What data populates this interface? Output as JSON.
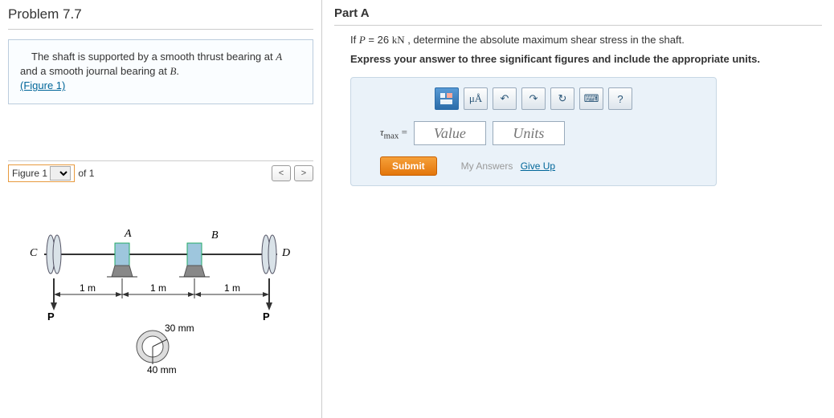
{
  "problem": {
    "title": "Problem 7.7",
    "intro_pre": "The shaft is supported by a smooth thrust bearing at ",
    "intro_A": "A",
    "intro_mid": " and a smooth journal bearing at ",
    "intro_B": "B",
    "intro_post": ".",
    "figure_link": "(Figure 1)"
  },
  "figure_bar": {
    "select_label": "Figure 1",
    "of_label": "of 1",
    "prev": "<",
    "next": ">"
  },
  "figure": {
    "labels": {
      "C": "C",
      "A": "A",
      "B": "B",
      "D": "D",
      "P1": "P",
      "P2": "P"
    },
    "dims": {
      "d1": "1 m",
      "d2": "1 m",
      "d3": "1 m",
      "r_in": "30 mm",
      "r_out": "40 mm"
    }
  },
  "partA": {
    "title": "Part A",
    "prompt_pre": "If ",
    "prompt_var": "P",
    "prompt_eq": " = 26 ",
    "prompt_unit": "kN",
    "prompt_post": " , determine the absolute maximum shear stress in the shaft.",
    "instruction": "Express your answer to three significant figures and include the appropriate units.",
    "tools": {
      "templates": "templates-icon",
      "ua": "μÅ",
      "undo": "↶",
      "redo": "↷",
      "reset": "↻",
      "keyboard": "⌨",
      "help": "?"
    },
    "answer_label_var": "τ",
    "answer_label_sub": "max",
    "answer_label_eq": " = ",
    "value_placeholder": "Value",
    "units_placeholder": "Units",
    "submit": "Submit",
    "my_answers": "My Answers",
    "give_up": "Give Up"
  },
  "chart_data": {
    "type": "diagram",
    "description": "Shaft C-A-B-D with thrust bearing at A, journal bearing at B, loads P down at C and P down at D",
    "points": [
      "C",
      "A",
      "B",
      "D"
    ],
    "spans_m": [
      1,
      1,
      1
    ],
    "P_kN": 26,
    "cross_section": {
      "outer_radius_mm": 40,
      "inner_radius_mm": 30,
      "shape": "hollow-circle"
    }
  }
}
